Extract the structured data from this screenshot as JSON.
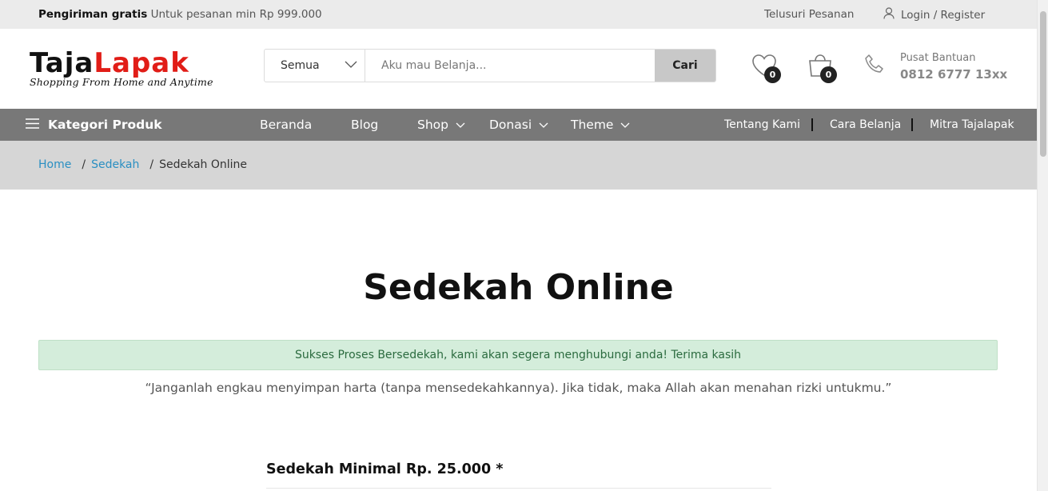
{
  "topbar": {
    "promo_bold": "Pengiriman gratis",
    "promo_text": "Untuk pesanan min Rp 999.000",
    "track_order": "Telusuri Pesanan",
    "login_register": "Login / Register"
  },
  "header": {
    "logo_part1": "Taja",
    "logo_part2": "Lapak",
    "logo_tagline": "Shopping From Home and Anytime",
    "search_category": "Semua",
    "search_placeholder": "Aku mau Belanja...",
    "search_button": "Cari",
    "wishlist_count": "0",
    "cart_count": "0",
    "help_label": "Pusat Bantuan",
    "help_phone": "0812 6777 13xx"
  },
  "nav": {
    "categories_label": "Kategori Produk",
    "items": [
      {
        "label": "Beranda"
      },
      {
        "label": "Blog"
      },
      {
        "label": "Shop"
      },
      {
        "label": "Donasi"
      },
      {
        "label": "Theme"
      }
    ],
    "right_links": [
      {
        "label": "Tentang Kami"
      },
      {
        "label": "Cara Belanja"
      },
      {
        "label": "Mitra Tajalapak"
      }
    ]
  },
  "breadcrumb": {
    "home": "Home",
    "parent": "Sedekah",
    "current": "Sedekah Online",
    "separator": "/"
  },
  "main": {
    "title": "Sedekah Online",
    "success_message": "Sukses Proses Bersedekah, kami akan segera menghubungi anda! Terima kasih",
    "quote": "“Janganlah engkau menyimpan harta (tanpa mensedekahkannya). Jika tidak, maka Allah akan menahan rizki untukmu.”",
    "min_label": "Sedekah Minimal Rp. 25.000 *"
  },
  "colors": {
    "nav_bg": "#787878",
    "logo_red": "#e11d17",
    "link_blue": "#2a8fc2",
    "alert_bg": "#d4eddb"
  }
}
